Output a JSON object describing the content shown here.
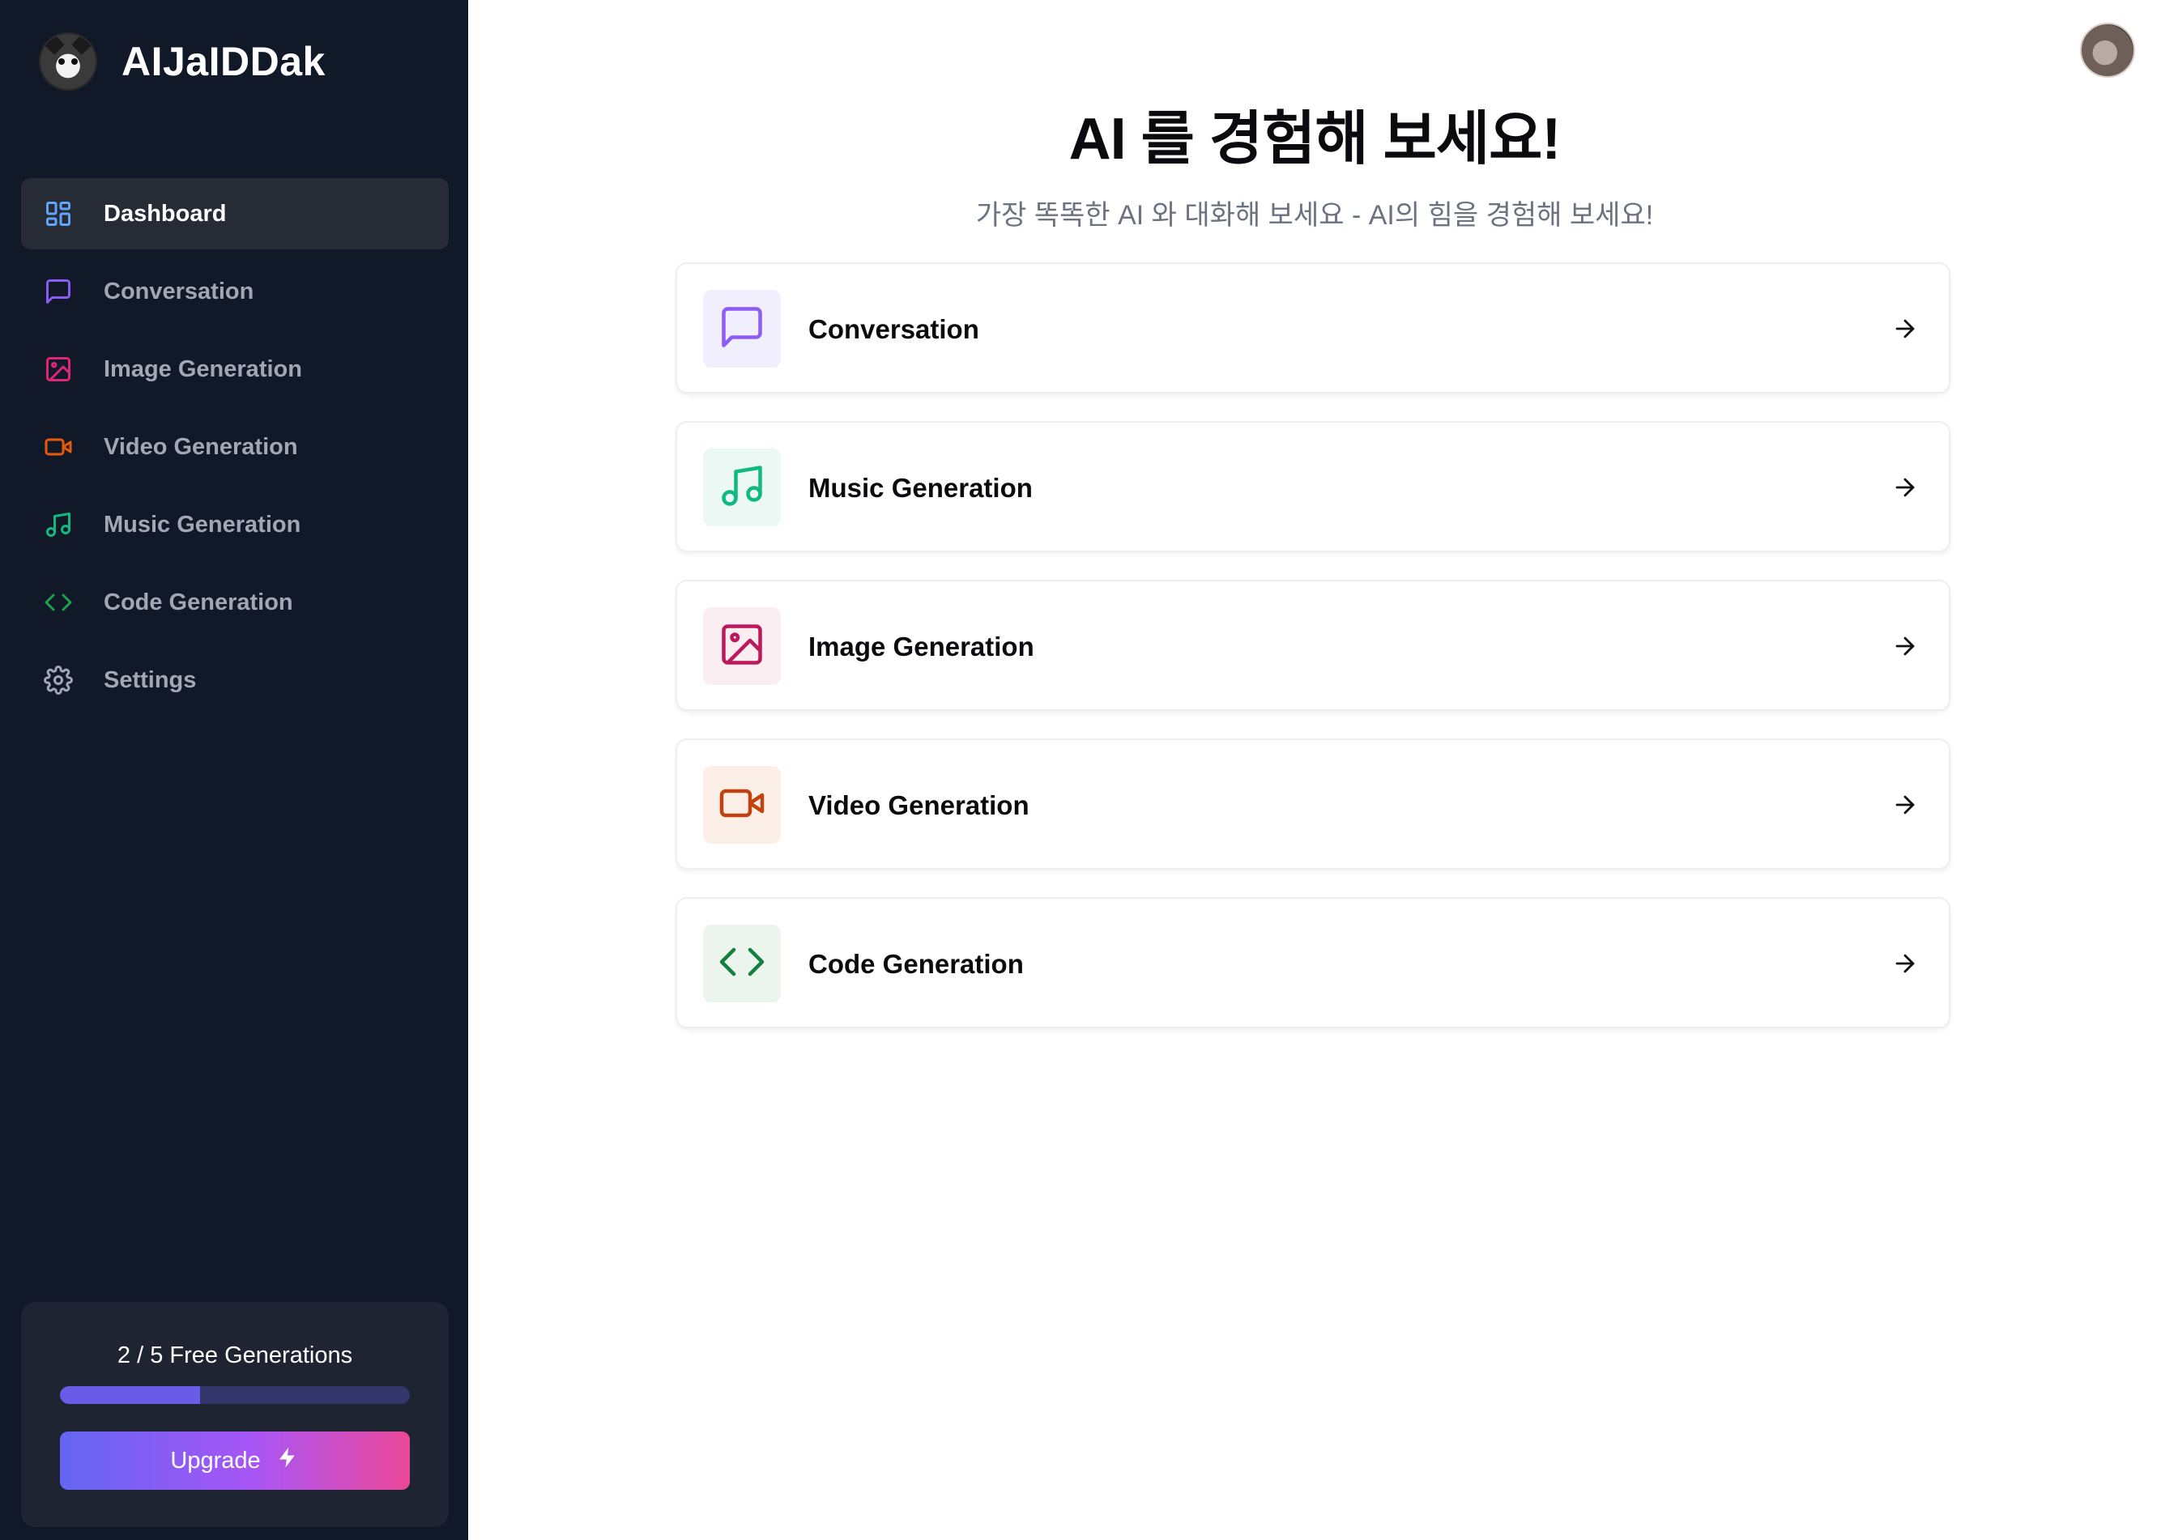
{
  "brand": {
    "name": "AIJaIDDak"
  },
  "nav": {
    "items": [
      {
        "label": "Dashboard",
        "icon": "dashboard-icon",
        "color": "#60a5fa",
        "active": true
      },
      {
        "label": "Conversation",
        "icon": "message-icon",
        "color": "#8b5cf6"
      },
      {
        "label": "Image Generation",
        "icon": "image-icon",
        "color": "#db2777"
      },
      {
        "label": "Video Generation",
        "icon": "video-icon",
        "color": "#ea580c"
      },
      {
        "label": "Music Generation",
        "icon": "music-icon",
        "color": "#10b981"
      },
      {
        "label": "Code Generation",
        "icon": "code-icon",
        "color": "#16a34a"
      },
      {
        "label": "Settings",
        "icon": "gear-icon",
        "color": "#a1a7b3"
      }
    ]
  },
  "usage": {
    "text": "2 / 5 Free Generations",
    "used": 2,
    "limit": 5,
    "upgrade_label": "Upgrade"
  },
  "main": {
    "heading": "AI 를 경험해 보세요!",
    "subheading": "가장 똑똑한 AI 와 대화해 보세요 - AI의 힘을 경험해 보세요!",
    "cards": [
      {
        "label": "Conversation",
        "icon": "message-icon",
        "color": "#8b5cf6",
        "bg": "#f1eefe"
      },
      {
        "label": "Music Generation",
        "icon": "music-icon",
        "color": "#10b981",
        "bg": "#ecf8f3"
      },
      {
        "label": "Image Generation",
        "icon": "image-icon",
        "color": "#be185d",
        "bg": "#fbeef2"
      },
      {
        "label": "Video Generation",
        "icon": "video-icon",
        "color": "#c2410c",
        "bg": "#fcefe8"
      },
      {
        "label": "Code Generation",
        "icon": "code-icon",
        "color": "#15803d",
        "bg": "#ecf4ee"
      }
    ]
  }
}
